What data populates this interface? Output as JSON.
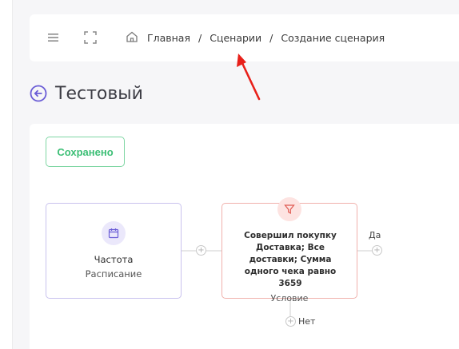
{
  "header": {
    "breadcrumbs": [
      "Главная",
      "Сценарии",
      "Создание сценария"
    ],
    "separator": "/"
  },
  "page": {
    "title": "Тестовый"
  },
  "editor": {
    "save_status": "Сохранено",
    "nodes": [
      {
        "title": "Частота",
        "subtitle": "Расписание",
        "icon": "calendar-icon"
      },
      {
        "text": "Совершил покупку Доставка; Все доставки; Сумма одного чека равно 3659",
        "type": "Условие",
        "icon": "filter-icon"
      }
    ],
    "branch_yes": "Да",
    "branch_no": "Нет"
  },
  "colors": {
    "accent": "#6a5cd6",
    "saved_green": "#3dbf76",
    "condition_red": "#e05a52",
    "arrow_red": "#e8201a"
  }
}
